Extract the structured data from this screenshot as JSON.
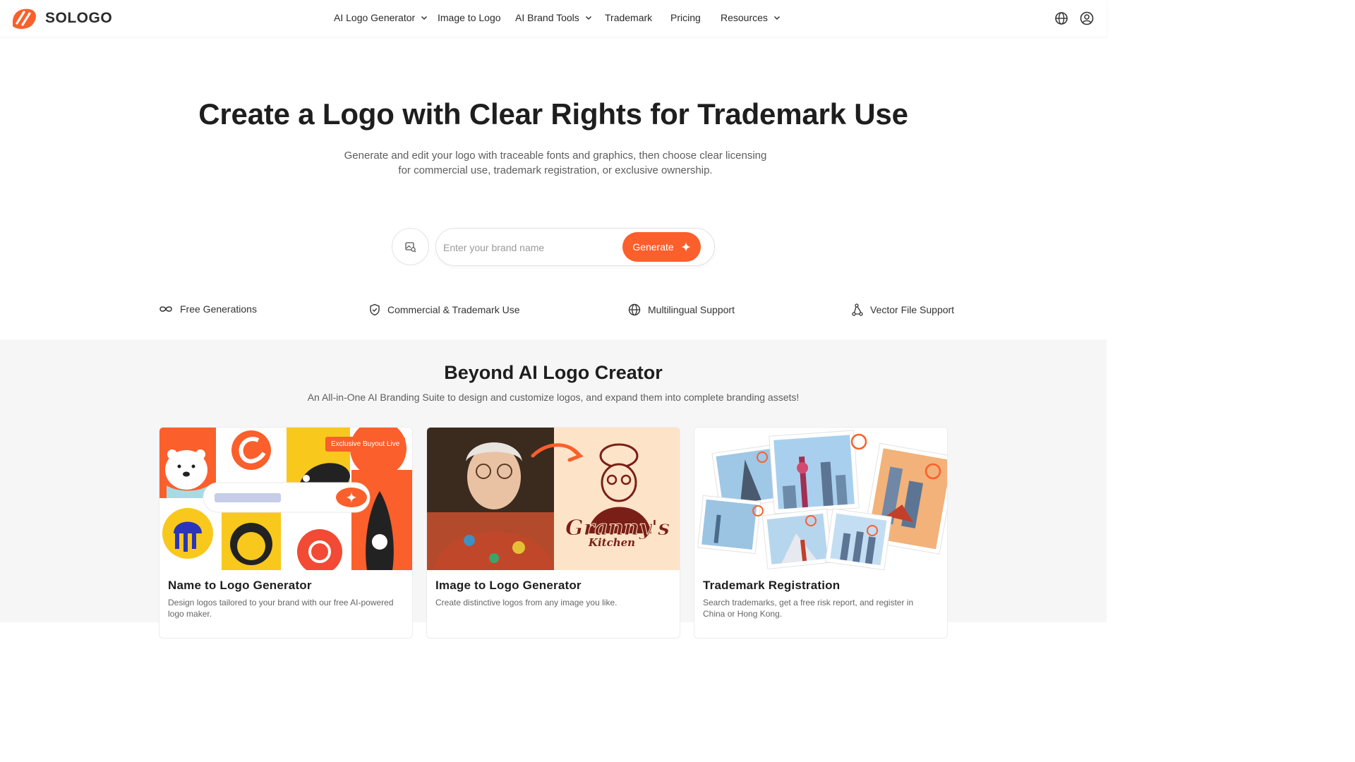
{
  "brand": {
    "name": "SOLOGO",
    "accent": "#fb5f2b"
  },
  "nav": {
    "items": [
      {
        "label": "AI Logo Generator",
        "dropdown": true
      },
      {
        "label": "Image to Logo",
        "dropdown": false
      },
      {
        "label": "AI Brand Tools",
        "dropdown": true
      },
      {
        "label": "Trademark",
        "dropdown": false
      },
      {
        "label": "Pricing",
        "dropdown": false
      },
      {
        "label": "Resources",
        "dropdown": true
      }
    ],
    "right_icons": [
      "globe-icon",
      "user-circle-icon"
    ]
  },
  "hero": {
    "title": "Create a Logo with Clear Rights for Trademark Use",
    "subtitle": "Generate and edit your logo with traceable fonts and graphics, then choose clear licensing for commercial use, trademark registration, or exclusive ownership.",
    "search_placeholder": "Enter your brand name",
    "search_value": "",
    "generate_label": "Generate"
  },
  "features": [
    {
      "label": "Free Generations",
      "icon": "infinity-icon"
    },
    {
      "label": "Commercial & Trademark Use",
      "icon": "shield-check-icon"
    },
    {
      "label": "Multilingual Support",
      "icon": "globe-icon"
    },
    {
      "label": "Vector File Support",
      "icon": "vector-nodes-icon"
    }
  ],
  "section": {
    "title": "Beyond AI Logo Creator",
    "subtitle": "An All-in-One AI Branding Suite to design and customize logos, and expand them into complete branding assets!",
    "cards": [
      {
        "title": "Name to Logo Generator",
        "desc": "Design logos tailored to your brand with our free AI-powered logo maker.",
        "badge": "Exclusive Buyout Live"
      },
      {
        "title": "Image to Logo Generator",
        "desc": "Create distinctive logos from any image you like.",
        "image_text_1": "Granny's",
        "image_text_2": "Kitchen"
      },
      {
        "title": "Trademark Registration",
        "desc": "Search trademarks, get a free risk report, and register in China or Hong Kong."
      }
    ]
  }
}
